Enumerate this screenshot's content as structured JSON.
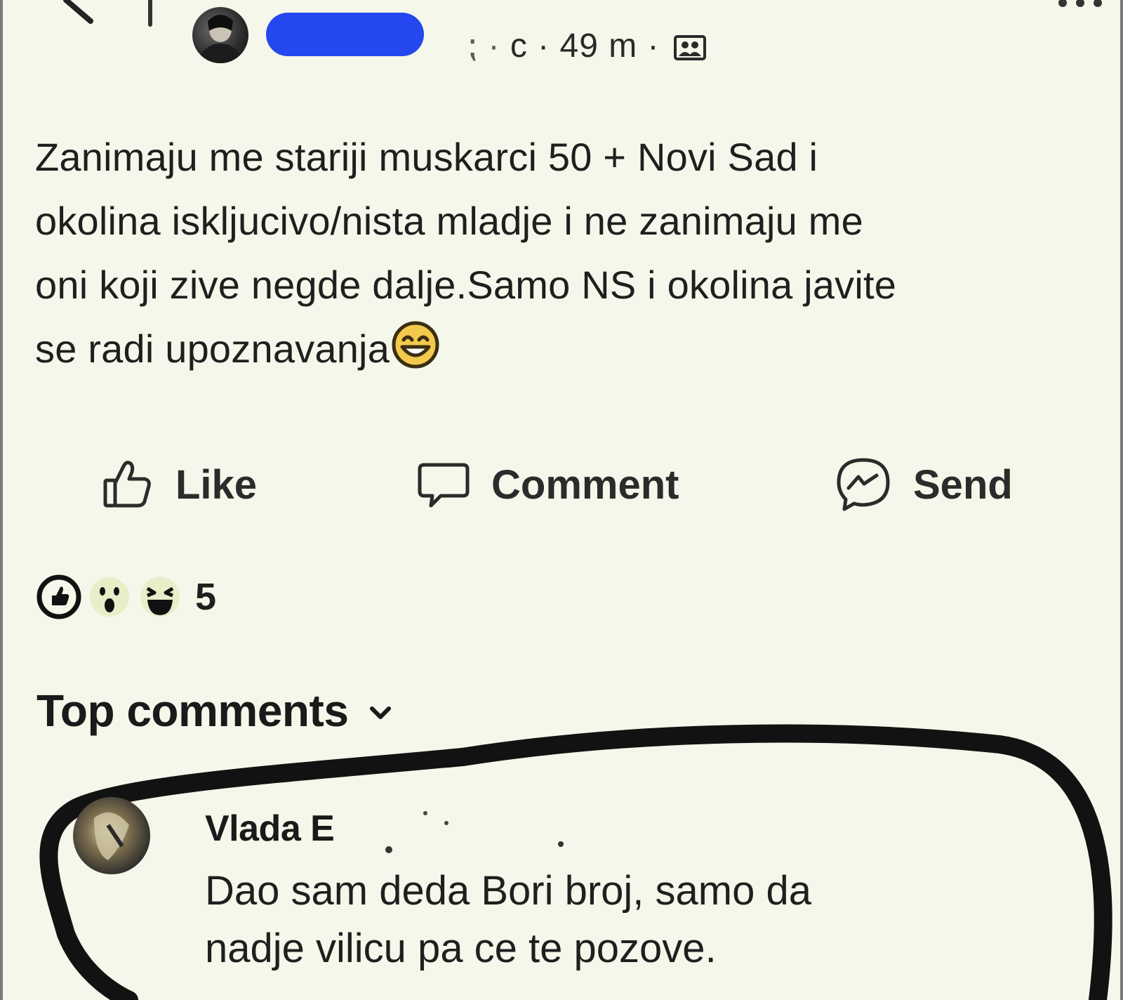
{
  "post": {
    "meta_time": "c · 49 m ·",
    "text_lines": [
      "Zanimaju me stariji muskarci 50 + Novi Sad i",
      "okolina iskljucivo/nista mladje i ne zanimaju me",
      "oni koji zive negde dalje.Samo NS i okolina javite",
      "se radi upoznavanja"
    ],
    "icons": {
      "audience": "friends-icon",
      "emoji": "smiling-face-icon"
    }
  },
  "actions": {
    "like_label": "Like",
    "comment_label": "Comment",
    "send_label": "Send"
  },
  "reactions": {
    "count": "5",
    "icons": [
      "like-reaction-icon",
      "wow-reaction-icon",
      "haha-reaction-icon"
    ]
  },
  "comments": {
    "section_label": "Top comments",
    "items": [
      {
        "author": "Vlada E",
        "text_lines": [
          "Dao sam deda Bori broj, samo da",
          "nadje vilicu pa ce te pozove."
        ]
      }
    ]
  },
  "colors": {
    "background": "#f4f7e9",
    "redaction": "#2447f0",
    "text": "#1f1f1f",
    "scribble": "#121212"
  }
}
